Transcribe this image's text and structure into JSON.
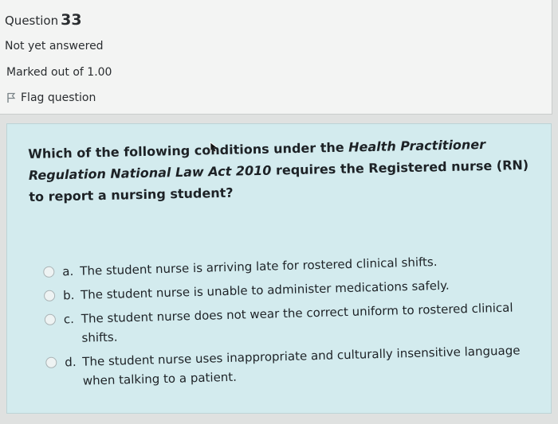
{
  "info": {
    "question_label": "Question",
    "question_number": "33",
    "state": "Not yet answered",
    "marked_out": "Marked out of 1.00",
    "flag_label": "Flag question"
  },
  "question": {
    "text_part1": "Which of the following conditions under the ",
    "text_italic": "Health Practitioner Regulation National Law Act 2010",
    "text_part2": " requires the Registered nurse (RN) to report a nursing student?"
  },
  "answers": [
    {
      "letter": "a.",
      "text": "The student nurse is arriving late for rostered clinical shifts."
    },
    {
      "letter": "b.",
      "text": "The student nurse is unable to administer medications safely."
    },
    {
      "letter": "c.",
      "text": "The student nurse does not wear the correct uniform to rostered clinical shifts."
    },
    {
      "letter": "d.",
      "text": "The student nurse uses inappropriate and culturally insensitive language when talking to a patient."
    }
  ]
}
